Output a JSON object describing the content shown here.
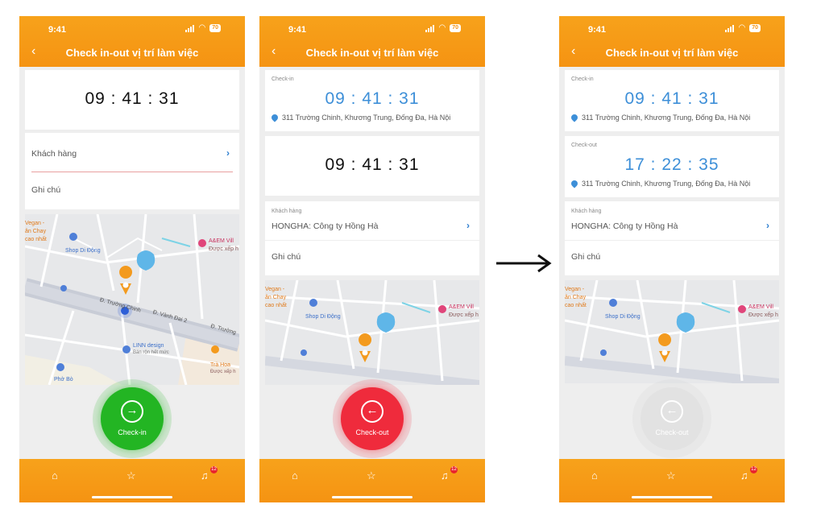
{
  "common": {
    "status_time": "9:41",
    "battery": "70",
    "header_title": "Check in-out vị trí làm việc",
    "notification_badge": "12"
  },
  "screen1": {
    "clock": "09 : 41 : 31",
    "customer_label": "Khách hàng",
    "note_label": "Ghi chú",
    "map": {
      "labels": [
        "Vegan -",
        "ân Chay",
        "cao nhất",
        "Shop Di Động",
        "A&EM Vill",
        "Được xếp h",
        "Đ. Trường Chinh",
        "Đ. Vành Đai 2",
        "Đ. Trường",
        "LINN design",
        "Bán rộn hết mức",
        "Trà Hoa",
        "Được xếp h",
        "Phở Bò"
      ]
    },
    "action_button": "Check-in"
  },
  "screen2": {
    "checkin_label": "Check-in",
    "checkin_time": "09 : 41 : 31",
    "checkin_address": "311 Trường Chinh, Khương Trung, Đống Đa, Hà Nội",
    "clock": "09 : 41 : 31",
    "customer_label": "Khách hàng",
    "customer_value": "HONGHA: Công ty Hồng Hà",
    "note_label": "Ghi chú",
    "map": {
      "labels": [
        "Vegan -",
        "ân Chay",
        "cao nhất",
        "Shop Di Động",
        "A&EM Vill",
        "Được xếp h"
      ]
    },
    "action_button": "Check-out"
  },
  "screen3": {
    "checkin_label": "Check-in",
    "checkin_time": "09 : 41 : 31",
    "checkin_address": "311 Trường Chinh, Khương Trung, Đống Đa, Hà Nội",
    "checkout_label": "Check-out",
    "checkout_time": "17 : 22 : 35",
    "checkout_address": "311 Trường Chinh, Khương Trung, Đống Đa, Hà Nội",
    "customer_label": "Khách hàng",
    "customer_value": "HONGHA: Công ty Hồng Hà",
    "note_label": "Ghi chú",
    "map": {
      "labels": [
        "Vegan -",
        "ân Chay",
        "cao nhất",
        "Shop Di Động",
        "A&EM Vill",
        "Được xếp h"
      ]
    },
    "action_button": "Check-out"
  },
  "colors": {
    "header_orange": "#f59312",
    "checkin_green": "#23b523",
    "checkout_red": "#ef2b3c",
    "disabled_gray": "#e2e2e2",
    "time_blue": "#3d8fd8"
  },
  "icons": {
    "back": "chevron-left-icon",
    "chevron": "chevron-right-icon",
    "home": "home-icon",
    "star": "star-icon",
    "bell": "bell-icon",
    "checkin": "arrow-right-circle-icon",
    "checkout": "arrow-left-circle-icon",
    "flow_arrow": "arrow-right-icon"
  }
}
